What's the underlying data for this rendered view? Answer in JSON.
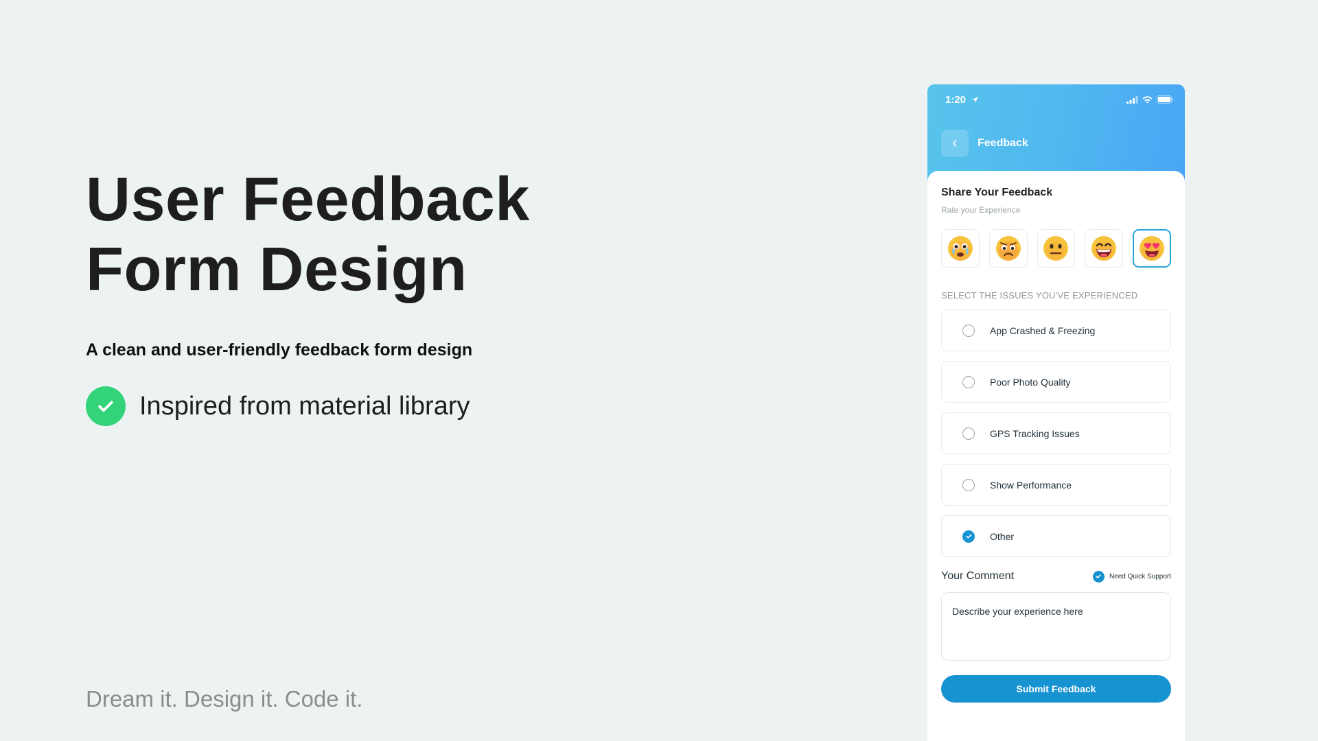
{
  "hero": {
    "title_line1": "User Feedback",
    "title_line2": "Form Design",
    "subtitle": "A clean and user-friendly feedback form design",
    "feature": "Inspired from material library",
    "tagline": "Dream it. Design it. Code it."
  },
  "phone": {
    "status": {
      "time": "1:20"
    },
    "nav": {
      "title": "Feedback"
    },
    "card": {
      "title": "Share Your Feedback",
      "subtitle": "Rate your Experience"
    },
    "ratings": [
      {
        "name": "crying-face"
      },
      {
        "name": "sad-face"
      },
      {
        "name": "neutral-face"
      },
      {
        "name": "grinning-face"
      },
      {
        "name": "heart-eyes-face",
        "selected": true
      }
    ],
    "issues_label": "SELECT THE ISSUES YOU'VE EXPERIENCED",
    "issues": [
      {
        "label": "App Crashed & Freezing",
        "checked": false
      },
      {
        "label": "Poor Photo Quality",
        "checked": false
      },
      {
        "label": "GPS Tracking Issues",
        "checked": false
      },
      {
        "label": "Show Performance",
        "checked": false
      },
      {
        "label": "Other",
        "checked": true
      }
    ],
    "comment": {
      "title": "Your Comment",
      "quick_support": "Need Quick Support",
      "placeholder": "Describe your experience here"
    },
    "submit_label": "Submit Feedback"
  },
  "colors": {
    "background": "#edf3f3",
    "accent": "#1793d2",
    "check_green": "#33d37a",
    "header_gradient_start": "#58c4ec",
    "header_gradient_end": "#4aa6f5"
  }
}
